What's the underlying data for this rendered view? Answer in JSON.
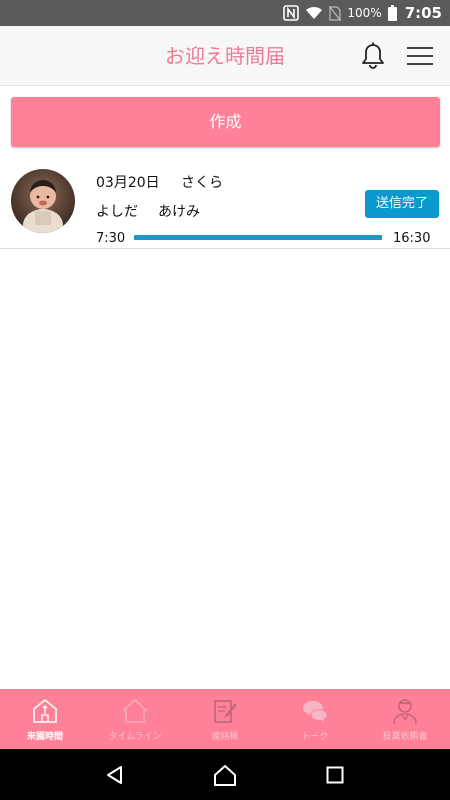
{
  "status_bar": {
    "battery_percent": "100%",
    "time": "7:05",
    "icons": [
      "nfc-icon",
      "wifi-icon",
      "no-sim-icon",
      "battery-icon"
    ]
  },
  "header": {
    "title": "お迎え時間届",
    "icons": [
      "bell-icon",
      "hamburger-menu-icon"
    ]
  },
  "create_button": {
    "label": "作成"
  },
  "entries": [
    {
      "date": "03月20日",
      "child_name": "さくら",
      "parent_last_name": "よしだ",
      "parent_first_name": "あけみ",
      "status": "送信完了",
      "start_time": "7:30",
      "end_time": "16:30"
    }
  ],
  "bottom_nav": {
    "items": [
      {
        "label": "来園時間",
        "icon": "kindergarten-time-icon",
        "active": true
      },
      {
        "label": "タイムライン",
        "icon": "house-icon",
        "active": false
      },
      {
        "label": "連絡帳",
        "icon": "notebook-pen-icon",
        "active": false
      },
      {
        "label": "トーク",
        "icon": "chat-bubbles-icon",
        "active": false
      },
      {
        "label": "投薬依頼書",
        "icon": "doctor-icon",
        "active": false
      }
    ]
  },
  "system_nav": [
    "back-icon",
    "home-icon",
    "recent-apps-icon"
  ],
  "colors": {
    "accent_pink": "#fe8198",
    "title_pink": "#f07b96",
    "badge_blue": "#0b98cc",
    "status_bar": "#5a5a5a"
  }
}
